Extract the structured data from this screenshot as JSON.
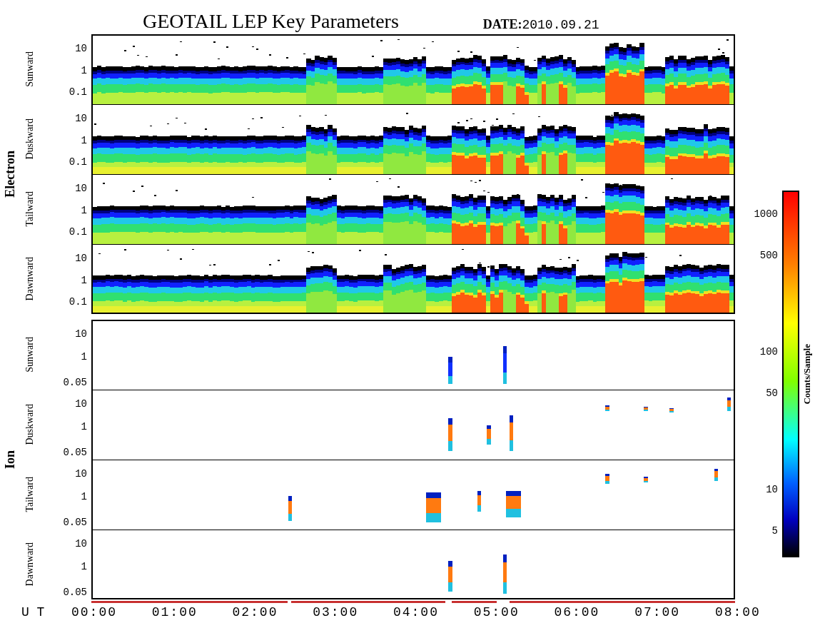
{
  "title": "GEOTAIL LEP Key Parameters",
  "date": {
    "label": "DATE:",
    "value": "2010.09.21"
  },
  "groups": [
    {
      "name": "Electron",
      "kind": "electron",
      "panels": [
        {
          "label": "Sunward",
          "yticks": [
            "10",
            "1",
            "0.1"
          ]
        },
        {
          "label": "Duskward",
          "yticks": [
            "10",
            "1",
            "0.1"
          ]
        },
        {
          "label": "Tailward",
          "yticks": [
            "10",
            "1",
            "0.1"
          ]
        },
        {
          "label": "Dawnward",
          "yticks": [
            "10",
            "1",
            "0.1"
          ]
        }
      ]
    },
    {
      "name": "Ion",
      "kind": "ion",
      "panels": [
        {
          "label": "Sunward",
          "yticks": [
            "10",
            "1",
            "0.05"
          ]
        },
        {
          "label": "Duskward",
          "yticks": [
            "10",
            "1",
            "0.05"
          ]
        },
        {
          "label": "Tailward",
          "yticks": [
            "10",
            "1",
            "0.05"
          ]
        },
        {
          "label": "Dawnward",
          "yticks": [
            "10",
            "1",
            "0.05"
          ]
        }
      ]
    }
  ],
  "time_axis": {
    "label": "U T",
    "ticks": [
      "00:00",
      "01:00",
      "02:00",
      "03:00",
      "04:00",
      "05:00",
      "06:00",
      "07:00",
      "08:00"
    ]
  },
  "colorbar": {
    "title": "Counts/Sample",
    "ticks": [
      "1000",
      "500",
      "100",
      "50",
      "10",
      "5"
    ]
  }
}
